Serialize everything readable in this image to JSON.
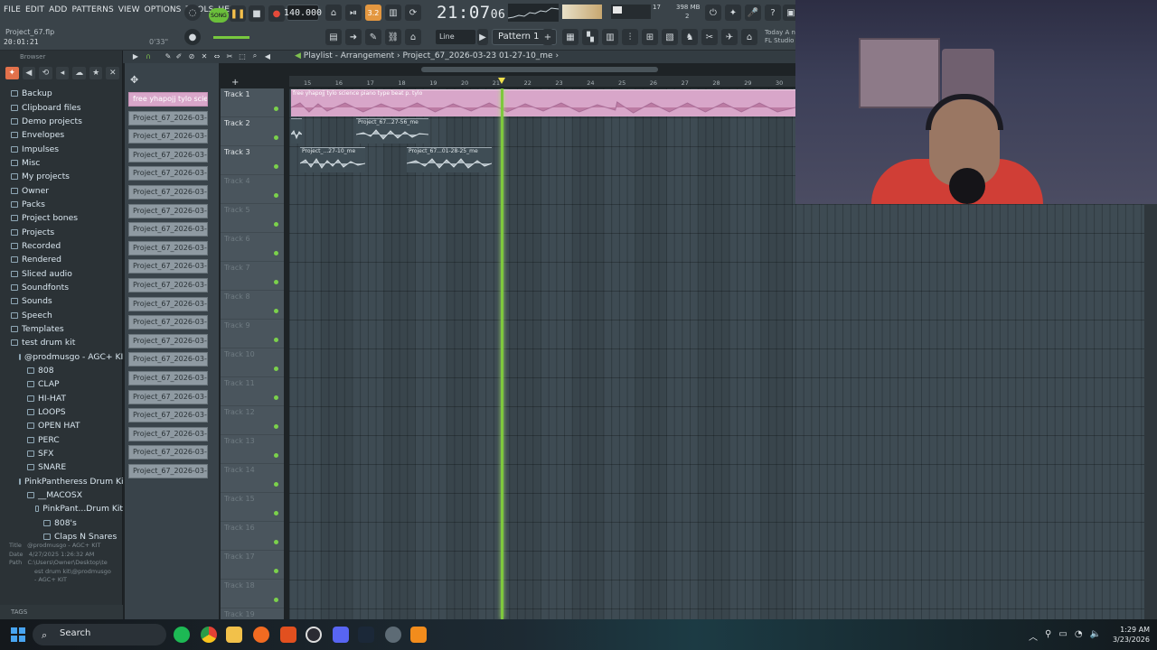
{
  "menu": [
    "FILE",
    "EDIT",
    "ADD",
    "PATTERNS",
    "VIEW",
    "OPTIONS",
    "TOOLS",
    "HELP"
  ],
  "project": {
    "file": "Project_67.flp",
    "time": "20:01:21",
    "length": "0'33\""
  },
  "transport": {
    "mode": "SONG",
    "tempo": "140.000",
    "clock": "21:07",
    "clock_small": "06",
    "step": "3.2"
  },
  "meters": {
    "memory": "398 MB",
    "poly": "17",
    "cpu_label": "2"
  },
  "toolbar": {
    "line_mode": "Line",
    "pattern": "Pattern 1"
  },
  "news": {
    "line1": "Today  A n",
    "line2": "FL Studio"
  },
  "browser": {
    "title": "Browser",
    "items": [
      {
        "label": "Backup",
        "level": 0
      },
      {
        "label": "Clipboard files",
        "level": 0
      },
      {
        "label": "Demo projects",
        "level": 0
      },
      {
        "label": "Envelopes",
        "level": 0
      },
      {
        "label": "Impulses",
        "level": 0
      },
      {
        "label": "Misc",
        "level": 0
      },
      {
        "label": "My projects",
        "level": 0
      },
      {
        "label": "Owner",
        "level": 0
      },
      {
        "label": "Packs",
        "level": 0
      },
      {
        "label": "Project bones",
        "level": 0
      },
      {
        "label": "Projects",
        "level": 0
      },
      {
        "label": "Recorded",
        "level": 0
      },
      {
        "label": "Rendered",
        "level": 0
      },
      {
        "label": "Sliced audio",
        "level": 0
      },
      {
        "label": "Soundfonts",
        "level": 0
      },
      {
        "label": "Sounds",
        "level": 0
      },
      {
        "label": "Speech",
        "level": 0
      },
      {
        "label": "Templates",
        "level": 0
      },
      {
        "label": "test drum kit",
        "level": 0
      },
      {
        "label": "@prodmusgo - AGC+ KIT",
        "level": 1
      },
      {
        "label": "808",
        "level": 2
      },
      {
        "label": "CLAP",
        "level": 2
      },
      {
        "label": "HI-HAT",
        "level": 2
      },
      {
        "label": "LOOPS",
        "level": 2
      },
      {
        "label": "OPEN HAT",
        "level": 2
      },
      {
        "label": "PERC",
        "level": 2
      },
      {
        "label": "SFX",
        "level": 2
      },
      {
        "label": "SNARE",
        "level": 2
      },
      {
        "label": "PinkPantheress Drum Kit",
        "level": 1
      },
      {
        "label": "__MACOSX",
        "level": 2
      },
      {
        "label": "PinkPant...Drum Kit",
        "level": 3
      },
      {
        "label": "808's",
        "level": 4
      },
      {
        "label": "Claps N Snares",
        "level": 4
      }
    ],
    "info": {
      "title_label": "Title",
      "title_value": "@prodmusgo - AGC+ KIT",
      "date_label": "Date",
      "date_value": "4/27/2025 1:26:32 AM",
      "path_label": "Path",
      "path_value": "C:\\Users\\Owner\\Desktop\\te",
      "path_value2": "est drum kit\\@prodmusgo",
      "path_value3": "- AGC+ KIT"
    },
    "tags_label": "TAGS"
  },
  "picker": {
    "clips": [
      "free yhapojj tylo scie...",
      "Project_67_2026-03-23...",
      "Project_67_2026-03-23...",
      "Project_67_2026-03-23...",
      "Project_67_2026-03-23...",
      "Project_67_2026-03-23...",
      "Project_67_2026-03-23...",
      "Project_67_2026-03-23...",
      "Project_67_2026-03-23...",
      "Project_67_2026-03-23...",
      "Project_67_2026-03-23...",
      "Project_67_2026-03-23...",
      "Project_67_2026-03-23...",
      "Project_67_2026-03-23...",
      "Project_67_2026-03-23...",
      "Project_67_2026-03-23...",
      "Project_67_2026-03-23...",
      "Project_67_2026-03-23...",
      "Project_67_2026-03-23...",
      "Project_67_2026-03-23...",
      "Project_67_2026-03-23..."
    ]
  },
  "playlist": {
    "title_prefix": "Playlist - Arrangement",
    "title_sep": "›",
    "title_name": "Project_67_2026-03-23 01-27-10_me",
    "ruler": [
      "15",
      "16",
      "17",
      "18",
      "19",
      "20",
      "21",
      "22",
      "23",
      "24",
      "25",
      "26",
      "27",
      "28",
      "29",
      "30"
    ],
    "tracks": [
      "Track 1",
      "Track 2",
      "Track 3",
      "Track 4",
      "Track 5",
      "Track 6",
      "Track 7",
      "Track 8",
      "Track 9",
      "Track 10",
      "Track 11",
      "Track 12",
      "Track 13",
      "Track 14",
      "Track 15",
      "Track 16",
      "Track 17",
      "Track 18",
      "Track 19"
    ],
    "clip1_label": "free yhapojj tylo science piano type beat p. tylo",
    "clip2_label": "Project_67...27-56_me",
    "clip3_label": "Project_...27-10_me",
    "clip4_label": "Project_67...01-28-25_me"
  },
  "taskbar": {
    "search": "Search",
    "time": "1:29 AM",
    "date": "3/23/2026"
  },
  "colors": {
    "accent": "#7ec83d",
    "audio_clip": "#d8a6c9",
    "record": "#e54a3a"
  }
}
